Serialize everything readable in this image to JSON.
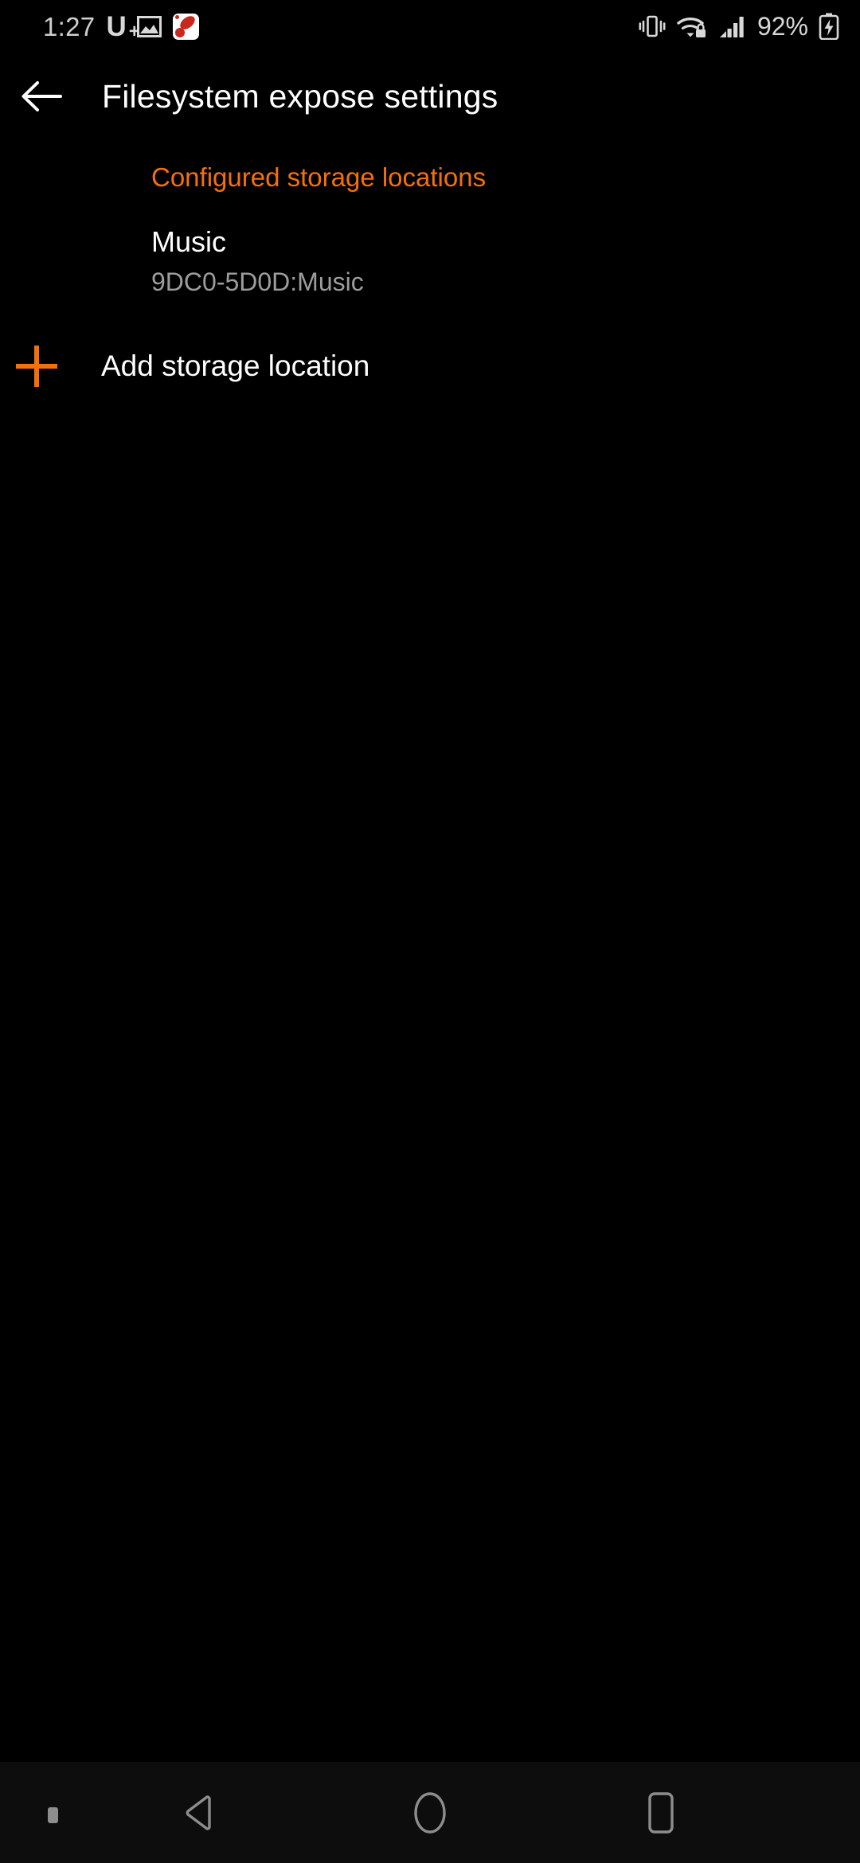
{
  "status_bar": {
    "clock": "1:27",
    "carrier_label": "U",
    "carrier_sup": "+",
    "battery_percent": "92%",
    "icons": [
      "photo-icon",
      "app-badge-icon",
      "vibrate-icon",
      "wifi-lock-icon",
      "signal-bars-icon",
      "battery-charging-icon"
    ]
  },
  "toolbar": {
    "back_icon": "back-arrow-icon",
    "title": "Filesystem expose settings"
  },
  "content": {
    "section_header": "Configured storage locations",
    "storage_locations": [
      {
        "name": "Music",
        "path": "9DC0-5D0D:Music"
      }
    ],
    "add_row": {
      "icon": "plus-icon",
      "label": "Add storage location"
    }
  },
  "nav_bar": {
    "pin_indicator": "pin-dot-icon",
    "back": "nav-back-icon",
    "home": "nav-home-icon",
    "recents": "nav-recents-icon"
  },
  "colors": {
    "background": "#000000",
    "accent_orange": "#f4700c",
    "primary_text": "#ffffff",
    "secondary_text": "#9d9d9d",
    "status_text": "#cfcfcf",
    "nav_background": "#0d0d0d",
    "nav_icon": "#8d8d8d"
  }
}
